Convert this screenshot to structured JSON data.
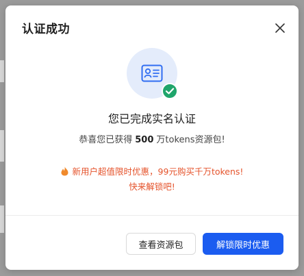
{
  "modal": {
    "title": "认证成功",
    "heading": "您已完成实名认证",
    "subtext": {
      "before": "恭喜您已获得",
      "amount": "500",
      "after": "万tokens资源包!"
    },
    "promo": {
      "line1": "新用户超值限时优惠，99元购买千万tokens!",
      "line2": "快来解锁吧!"
    },
    "buttons": {
      "secondary": "查看资源包",
      "primary": "解锁限时优惠"
    }
  },
  "icons": {
    "close": "close-icon",
    "hero": "id-card-icon",
    "badge": "check-circle-icon",
    "promo": "flame-icon"
  },
  "colors": {
    "primary": "#1b5cf0",
    "success": "#1fa56b",
    "promo": "#e5532b",
    "hero_bg": "#e4ecfb"
  }
}
